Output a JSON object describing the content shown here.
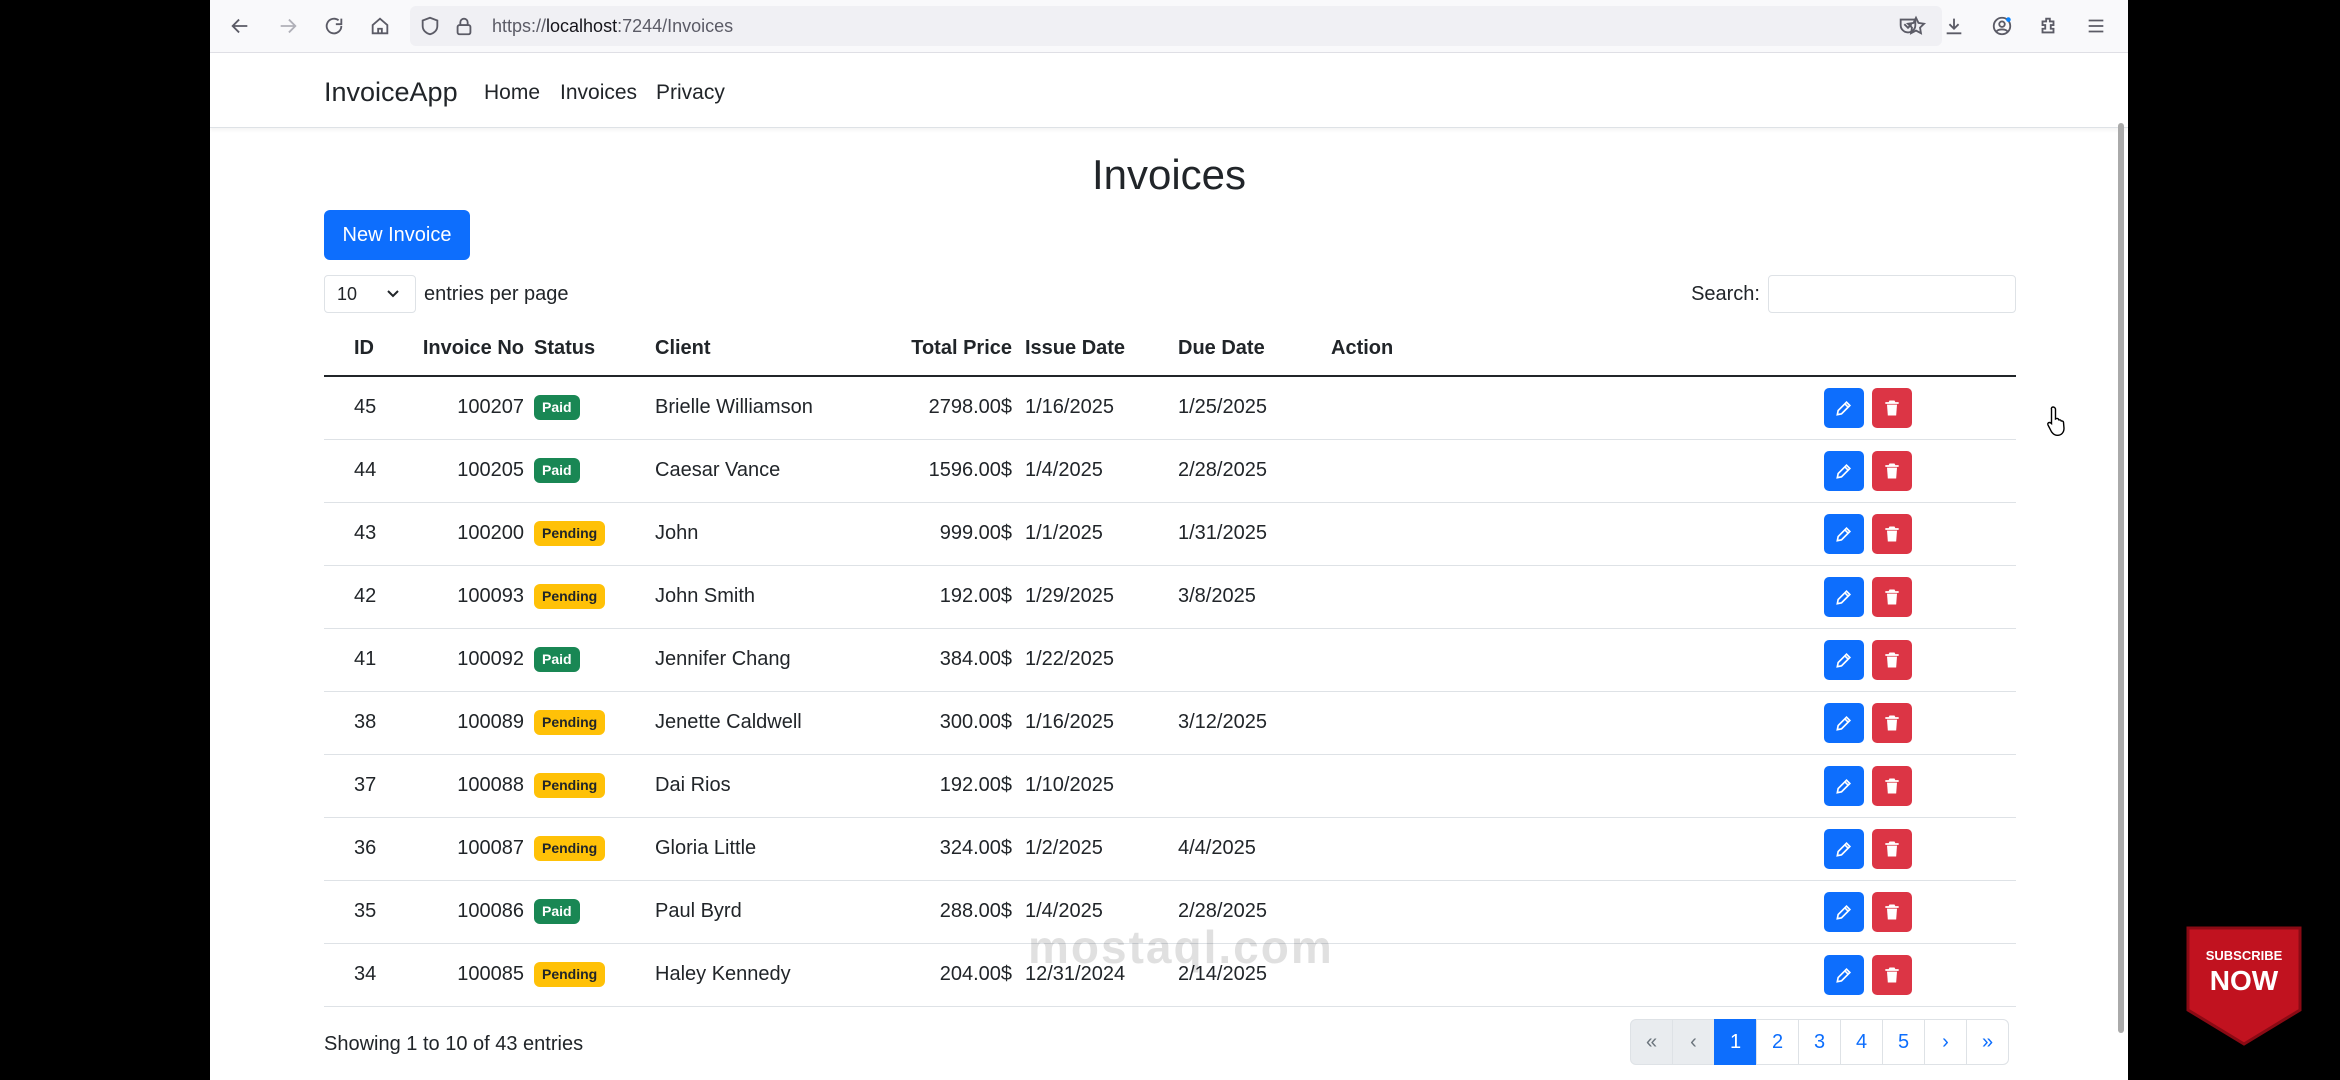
{
  "browser": {
    "url_prefix": "https://",
    "url_host": "localhost",
    "url_path": ":7244/Invoices"
  },
  "nav": {
    "brand": "InvoiceApp",
    "links": [
      "Home",
      "Invoices",
      "Privacy"
    ]
  },
  "page": {
    "title": "Invoices",
    "new_button": "New Invoice",
    "length_value": "10",
    "length_label": "entries per page",
    "search_label": "Search:",
    "search_value": ""
  },
  "table": {
    "headers": [
      "ID",
      "Invoice No",
      "Status",
      "Client",
      "Total Price",
      "Issue Date",
      "Due Date",
      "Action"
    ],
    "rows": [
      {
        "id": "45",
        "invoice_no": "100207",
        "status": "Paid",
        "client": "Brielle Williamson",
        "total": "2798.00$",
        "issue": "1/16/2025",
        "due": "1/25/2025"
      },
      {
        "id": "44",
        "invoice_no": "100205",
        "status": "Paid",
        "client": "Caesar Vance",
        "total": "1596.00$",
        "issue": "1/4/2025",
        "due": "2/28/2025"
      },
      {
        "id": "43",
        "invoice_no": "100200",
        "status": "Pending",
        "client": "John",
        "total": "999.00$",
        "issue": "1/1/2025",
        "due": "1/31/2025"
      },
      {
        "id": "42",
        "invoice_no": "100093",
        "status": "Pending",
        "client": "John Smith",
        "total": "192.00$",
        "issue": "1/29/2025",
        "due": "3/8/2025"
      },
      {
        "id": "41",
        "invoice_no": "100092",
        "status": "Paid",
        "client": "Jennifer Chang",
        "total": "384.00$",
        "issue": "1/22/2025",
        "due": ""
      },
      {
        "id": "38",
        "invoice_no": "100089",
        "status": "Pending",
        "client": "Jenette Caldwell",
        "total": "300.00$",
        "issue": "1/16/2025",
        "due": "3/12/2025"
      },
      {
        "id": "37",
        "invoice_no": "100088",
        "status": "Pending",
        "client": "Dai Rios",
        "total": "192.00$",
        "issue": "1/10/2025",
        "due": ""
      },
      {
        "id": "36",
        "invoice_no": "100087",
        "status": "Pending",
        "client": "Gloria Little",
        "total": "324.00$",
        "issue": "1/2/2025",
        "due": "4/4/2025"
      },
      {
        "id": "35",
        "invoice_no": "100086",
        "status": "Paid",
        "client": "Paul Byrd",
        "total": "288.00$",
        "issue": "1/4/2025",
        "due": "2/28/2025"
      },
      {
        "id": "34",
        "invoice_no": "100085",
        "status": "Pending",
        "client": "Haley Kennedy",
        "total": "204.00$",
        "issue": "12/31/2024",
        "due": "2/14/2025"
      }
    ]
  },
  "footer": {
    "info": "Showing 1 to 10 of 43 entries",
    "pagination": [
      {
        "label": "«",
        "state": "disabled"
      },
      {
        "label": "‹",
        "state": "disabled"
      },
      {
        "label": "1",
        "state": "active"
      },
      {
        "label": "2",
        "state": "normal"
      },
      {
        "label": "3",
        "state": "normal"
      },
      {
        "label": "4",
        "state": "normal"
      },
      {
        "label": "5",
        "state": "normal"
      },
      {
        "label": "›",
        "state": "normal"
      },
      {
        "label": "»",
        "state": "normal"
      }
    ]
  },
  "overlay": {
    "watermark": "mostaql.com",
    "subscribe_line1": "SUBSCRIBE",
    "subscribe_line2": "NOW"
  },
  "colors": {
    "primary": "#0d6efd",
    "danger": "#dc3545",
    "success": "#198754",
    "warning": "#ffc107"
  },
  "icons": {
    "edit": "pencil-icon",
    "delete": "trash-icon"
  }
}
